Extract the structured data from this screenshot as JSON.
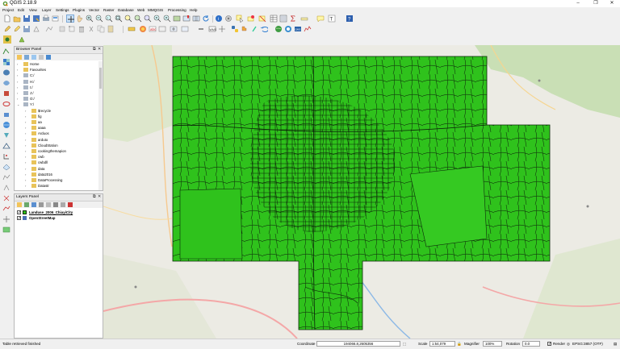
{
  "window": {
    "title": "QGIS 2.18.9",
    "minimize": "–",
    "maximize": "❐",
    "close": "✕"
  },
  "menu": [
    "Project",
    "Edit",
    "View",
    "Layer",
    "Settings",
    "Plugins",
    "Vector",
    "Raster",
    "Database",
    "Web",
    "MMQGIS",
    "Processing",
    "Help"
  ],
  "browser_panel": {
    "title": "Browser Panel",
    "items": [
      {
        "label": "Home",
        "type": "folder"
      },
      {
        "label": "Favourites",
        "type": "star"
      },
      {
        "label": "C:/",
        "type": "drive"
      },
      {
        "label": "H:/",
        "type": "drive"
      },
      {
        "label": "I:/",
        "type": "drive"
      },
      {
        "label": "J:/",
        "type": "drive"
      },
      {
        "label": "O:/",
        "type": "drive"
      },
      {
        "label": "Y:/",
        "type": "drive"
      },
      {
        "label": "$recycle",
        "type": "folder"
      },
      {
        "label": "fig",
        "type": "folder"
      },
      {
        "label": "aa",
        "type": "folder"
      },
      {
        "label": "aaaa",
        "type": "folder"
      },
      {
        "label": "Arduos",
        "type": "folder"
      },
      {
        "label": "arduto",
        "type": "folder"
      },
      {
        "label": "CloudStation",
        "type": "folder"
      },
      {
        "label": "cookingthemapion",
        "type": "folder"
      },
      {
        "label": "cwb",
        "type": "folder"
      },
      {
        "label": "cwbdll",
        "type": "folder"
      },
      {
        "label": "data",
        "type": "folder"
      },
      {
        "label": "data2016",
        "type": "folder"
      },
      {
        "label": "DataProcessing",
        "type": "folder"
      },
      {
        "label": "Datastr",
        "type": "folder"
      }
    ]
  },
  "layers_panel": {
    "title": "Layers Panel",
    "layers": [
      {
        "label": "Landuse_2006_ChiayiCity",
        "checked": true,
        "swatch": "#2fc21c"
      },
      {
        "label": "OpenStreetMap",
        "checked": true,
        "swatch": "#4a6fb5"
      }
    ]
  },
  "status": {
    "message": "Table retrieved finished",
    "coordinate_label": "Coordinate",
    "coordinate_value": "194066.8,2605356",
    "scale_label": "Scale",
    "scale_value": "1:54,079",
    "magnifier_label": "Magnifier",
    "magnifier_value": "100%",
    "rotation_label": "Rotation",
    "rotation_value": "0.0",
    "render_label": "Render",
    "render_checked": true,
    "crs": "EPSG:3857 (OTF)"
  },
  "colors": {
    "landuse_fill": "#2fc21c",
    "landuse_stroke": "#0d2a0b",
    "map_bg": "#ecebe4",
    "accent": "#3b6fb6"
  }
}
